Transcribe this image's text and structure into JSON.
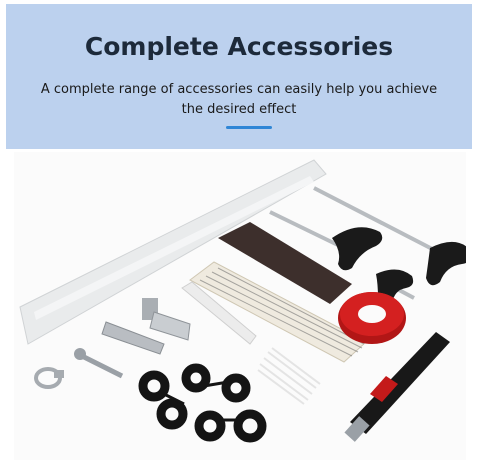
{
  "header": {
    "title": "Complete Accessories",
    "subtitle": "A complete range of accessories can easily help you achieve the desired effect",
    "accent_color": "#2f86d6",
    "banner_color": "#bcd1ee"
  },
  "product_photo": {
    "items": [
      "sealing-tape-strip",
      "t-handle-rods",
      "mastic-pad",
      "marker-label-sheet",
      "red-vinyl-tape",
      "hook-and-loop-strap",
      "mounting-brackets",
      "hose-clamp",
      "bolt",
      "rubber-washers",
      "cable-ties",
      "tube-nozzle"
    ]
  }
}
